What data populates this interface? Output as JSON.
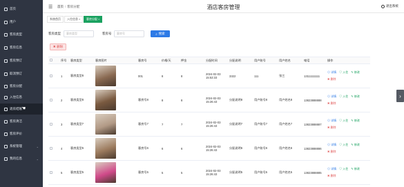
{
  "header": {
    "breadcrumb_home": "首页",
    "breadcrumb_current": "客房分配",
    "site_title": "酒店客房管理",
    "logout_label": "退出系统"
  },
  "sidebar": {
    "items": [
      {
        "label": "首页"
      },
      {
        "label": "用户"
      },
      {
        "label": "客房类型"
      },
      {
        "label": "客房信息"
      },
      {
        "label": "客房预订"
      },
      {
        "label": "取消预订"
      },
      {
        "label": "客房分配"
      },
      {
        "label": "入住信息"
      },
      {
        "label": "退房结账"
      },
      {
        "label": "客房清洁"
      },
      {
        "label": "客房评价"
      },
      {
        "label": "系统管理"
      },
      {
        "label": "我的信息"
      }
    ]
  },
  "tabs": [
    {
      "label": "系统首页"
    },
    {
      "label": "入住信息 ×"
    },
    {
      "label": "客房分配 ×"
    }
  ],
  "search": {
    "type_label": "客房类型",
    "type_placeholder": "客房类型",
    "number_label": "客房号",
    "number_placeholder": "客房号",
    "button_label": "搜索"
  },
  "delete_button_label": "删除",
  "table": {
    "headers": [
      "",
      "序号",
      "客房类型",
      "客房图片",
      "客房号",
      "价格/天",
      "押金",
      "分配时间",
      "分配说明",
      "用户账号",
      "用户姓名",
      "电话",
      "操作"
    ],
    "rows": [
      {
        "index": "1",
        "room_type": "客房类型8",
        "room_no": "001",
        "price": "8",
        "deposit": "8",
        "time": "2024-02-03 15:53:33",
        "note": "3322",
        "account": "111",
        "name": "张三",
        "phone": "13111111111",
        "photo_color": "#8a6a52"
      },
      {
        "index": "2",
        "room_type": "客房类型8",
        "room_no": "客房号8",
        "price": "8",
        "deposit": "8",
        "time": "2024-02-03 15:26:43",
        "note": "分配说明8",
        "account": "用户账号8",
        "name": "用户姓名8",
        "phone": "13823888888",
        "photo_color": "#7a5a40"
      },
      {
        "index": "3",
        "room_type": "客房类型7",
        "room_no": "客房号7",
        "price": "7",
        "deposit": "7",
        "time": "2024-02-03 15:26:43",
        "note": "分配说明7",
        "account": "用户账号7",
        "name": "用户姓名7",
        "phone": "13823888887",
        "photo_color": "#b29a86"
      },
      {
        "index": "4",
        "room_type": "客房类型6",
        "room_no": "客房号6",
        "price": "6",
        "deposit": "6",
        "time": "2024-02-03 15:26:43",
        "note": "分配说明6",
        "account": "用户账号6",
        "name": "用户姓名6",
        "phone": "13823888886",
        "photo_color": "#9c7b5e"
      },
      {
        "index": "5",
        "room_type": "客房类型5",
        "room_no": "客房号5",
        "price": "5",
        "deposit": "5",
        "time": "2024-02-03 15:26:43",
        "note": "分配说明5",
        "account": "用户账号5",
        "name": "用户姓名5",
        "phone": "13823888885",
        "photo_color": "#d04a8a"
      }
    ],
    "ops": {
      "detail": "详情",
      "checkin": "入住",
      "edit": "修改",
      "delete": "删除"
    }
  },
  "colors": {
    "sidebar_bg": "#2f3542",
    "primary": "#2d7ae6",
    "green": "#19a15f",
    "danger": "#e05555"
  }
}
